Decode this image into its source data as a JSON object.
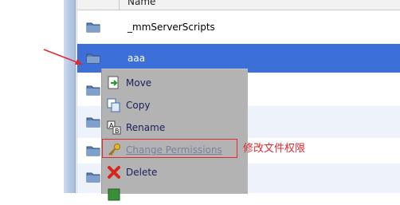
{
  "column_header": {
    "name_label": "Name"
  },
  "rows": [
    {
      "label": "_mmServerScripts"
    },
    {
      "label": "aaa"
    },
    {
      "label": ""
    },
    {
      "label": ""
    },
    {
      "label": ""
    },
    {
      "label": ""
    }
  ],
  "context_menu": {
    "items": [
      {
        "label": "Move",
        "icon": "move-icon"
      },
      {
        "label": "Copy",
        "icon": "copy-icon"
      },
      {
        "label": "Rename",
        "icon": "rename-icon"
      },
      {
        "label": "Change Permissions",
        "icon": "key-icon",
        "disabled": true
      },
      {
        "label": "Delete",
        "icon": "delete-icon"
      }
    ]
  },
  "annotation": {
    "text": "修改文件权限",
    "color": "#e0282e"
  },
  "colors": {
    "selection": "#3c6fd8",
    "menu_bg": "#b3b3b3",
    "highlight": "#e0282e"
  }
}
